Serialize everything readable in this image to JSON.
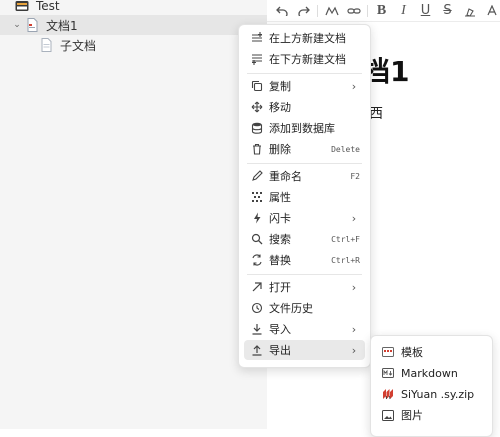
{
  "sidebar": {
    "notebook": "Test",
    "doc": "文档1",
    "child": "子文档"
  },
  "editor": {
    "title_fragment": "档1",
    "body_fragment": "西"
  },
  "context_menu": {
    "insert_above": "在上方新建文档",
    "insert_below": "在下方新建文档",
    "copy": "复制",
    "move": "移动",
    "add_database": "添加到数据库",
    "delete": "删除",
    "delete_shortcut": "Delete",
    "rename": "重命名",
    "rename_shortcut": "F2",
    "attributes": "属性",
    "flashcard": "闪卡",
    "search": "搜索",
    "search_shortcut": "Ctrl+F",
    "replace": "替换",
    "replace_shortcut": "Ctrl+R",
    "open": "打开",
    "history": "文件历史",
    "import": "导入",
    "export": "导出"
  },
  "export_submenu": {
    "template": "模板",
    "markdown": "Markdown",
    "siyuan": "SiYuan .sy.zip",
    "image": "图片"
  },
  "colors": {
    "accent_notebook": "#e8a33c",
    "hover": "#e9e9e9",
    "siyuan_red": "#d23f31"
  }
}
